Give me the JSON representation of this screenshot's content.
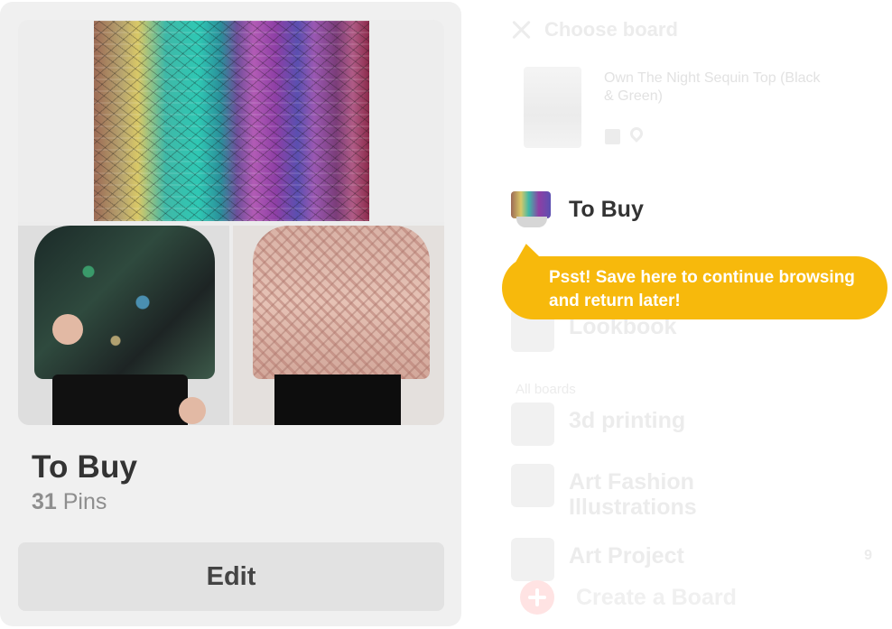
{
  "board_card": {
    "title": "To Buy",
    "pin_count": "31",
    "pin_label": " Pins",
    "edit_label": "Edit"
  },
  "panel": {
    "title": "Choose board",
    "pin": {
      "name": "Own The Night Sequin Top (Black & Green)",
      "icons": [
        "facebook-icon",
        "location-icon"
      ]
    },
    "selected_board": "To Buy",
    "recent_boards": [
      "Lookbook"
    ],
    "section_label": "All boards",
    "boards": [
      {
        "label": "3d printing"
      },
      {
        "label": "Art Fashion Illustrations"
      },
      {
        "label": "Art Project",
        "count": "9"
      }
    ],
    "create_label": "Create a Board"
  },
  "tooltip": {
    "text": "Psst! Save here to continue browsing and return later!"
  },
  "colors": {
    "tooltip_bg": "#f7b90c",
    "card_bg": "#f0f0f0",
    "edit_bg": "#e2e2e2",
    "title_text": "#333333"
  }
}
